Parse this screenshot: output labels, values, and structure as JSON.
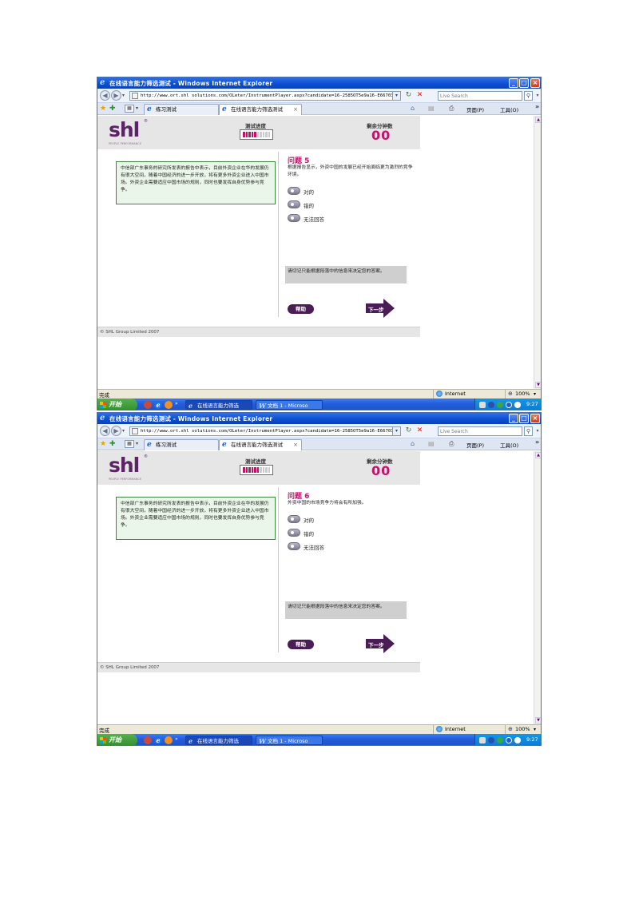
{
  "common": {
    "window_title": "在线语言能力筛选测试 - Windows Internet Explorer",
    "url": "http://www.ort.shl solutions.com/OLeter/InstrumentPlayer.aspx?candidate=16-2585OT5e9a16-E66703B-215",
    "search_placeholder": "Live Search",
    "tab1_label": "练习测试",
    "tab2_label": "在线语言能力筛选测试",
    "page_menu": "页面(P)",
    "tools_menu": "工具(O)",
    "logo_text": "shl",
    "logo_tagline": "PEOPLE PERFORMANCE",
    "progress_label": "测试进度",
    "timer_label": "剩余分钟数",
    "timer_value": "00",
    "passage": "中信部广东事务的研究所发表的报告中表示，目前外资企业在华的发展仍有很大空间，随着中国经济的进一步开放，将有更多外资企业进入中国市场。外资企业需要适应中国市场的规则，同时也要发挥自身优势参与竞争。",
    "option_labels": [
      "对的",
      "错的",
      "无法回答"
    ],
    "note": "请切记只能根据段落中的信息来决定您的答案。",
    "help_label": "帮助",
    "next_label": "下一步",
    "copyright": "© SHL Group Limited 2007",
    "status_done": "完成",
    "status_zone": "Internet",
    "status_zoom": "100%",
    "start_label": "开始",
    "task1": "在线语言能力筛选",
    "task2": "文档 1 - Microso",
    "clock": "9:27"
  },
  "screens": [
    {
      "question_title": "问题 5",
      "question_text": "根据报告显示，外资中国的发展已经开始面临更为激烈的竞争环境。",
      "progress": {
        "filled": 5,
        "total": 10
      }
    },
    {
      "question_title": "问题 6",
      "question_text": "外资中国的市场竞争力将会有所加强。",
      "progress": {
        "filled": 6,
        "total": 10
      }
    }
  ],
  "colors": {
    "accent": "#c2136a",
    "brand": "#5c2466",
    "xp_blue": "#0a4fd0"
  }
}
